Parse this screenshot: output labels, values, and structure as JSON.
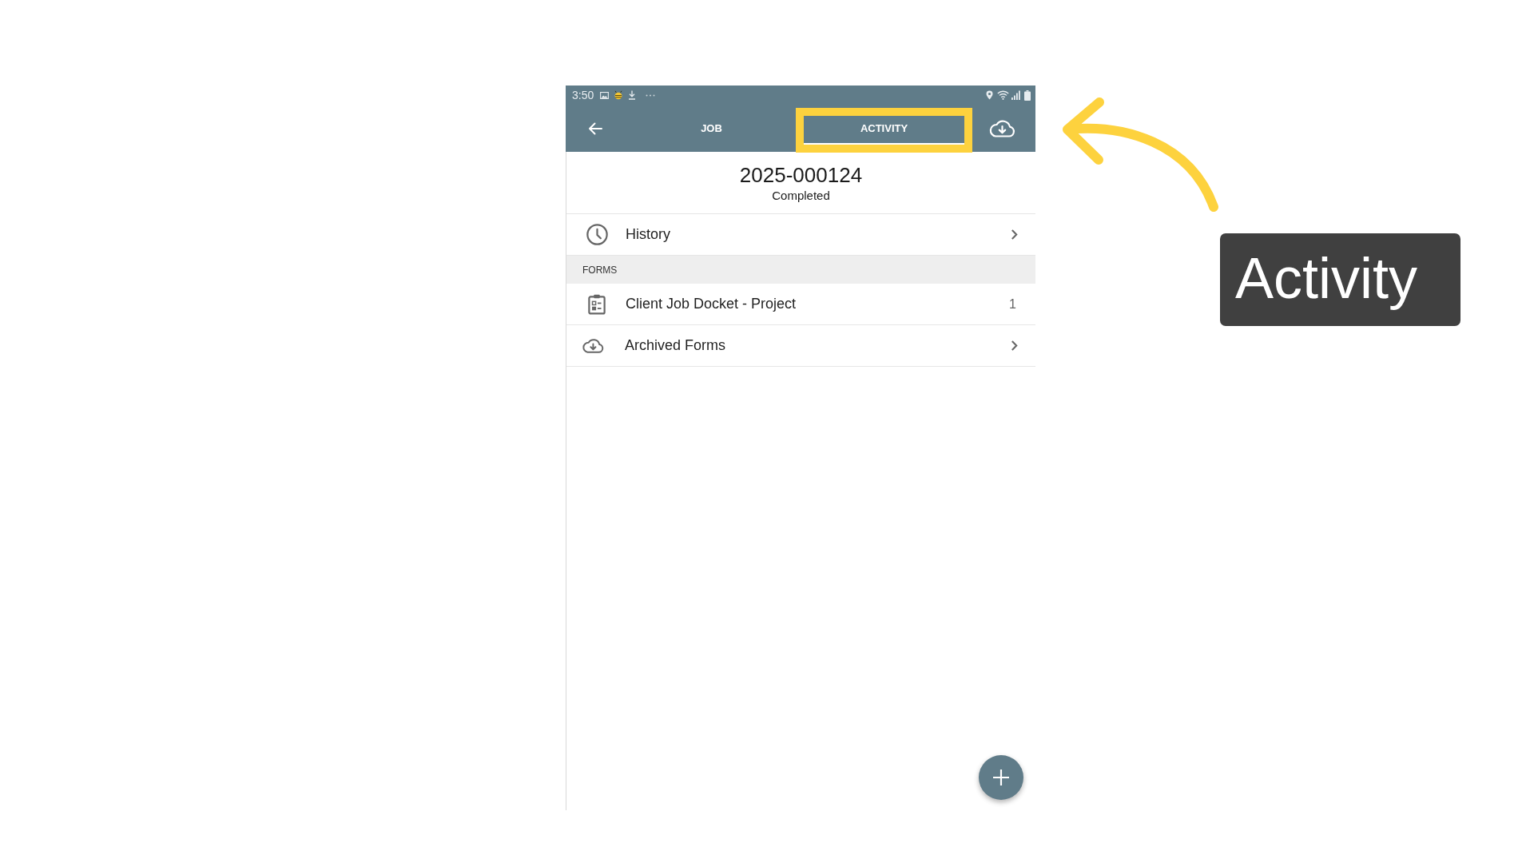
{
  "status_bar": {
    "time": "3:50"
  },
  "app_bar": {
    "tabs": [
      {
        "label": "JOB",
        "selected": false,
        "highlighted": false
      },
      {
        "label": "ACTIVITY",
        "selected": true,
        "highlighted": true
      }
    ]
  },
  "job": {
    "number": "2025-000124",
    "status": "Completed"
  },
  "history": {
    "label": "History"
  },
  "forms": {
    "title": "FORMS",
    "items": [
      {
        "kind": "form",
        "label": "Client Job Docket - Project",
        "count": "1"
      },
      {
        "kind": "archive",
        "label": "Archived Forms"
      }
    ]
  },
  "annotation": {
    "label": "Activity"
  }
}
